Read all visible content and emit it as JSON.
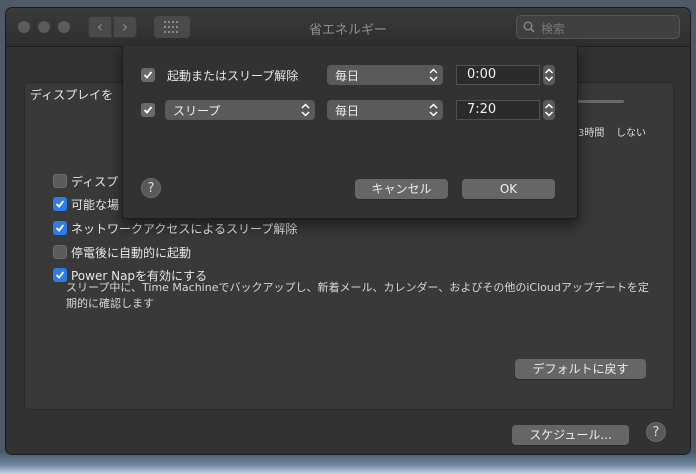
{
  "window": {
    "title": "省エネルギー"
  },
  "search": {
    "placeholder": "検索"
  },
  "panel": {
    "display_label": "ディスプレイを",
    "slider_ticks": [
      "3時間",
      "しない"
    ],
    "options": [
      {
        "label": "ディスプ",
        "checked": false
      },
      {
        "label": "可能な場",
        "checked": true
      },
      {
        "label": "ネットワークアクセスによるスリープ解除",
        "checked": true
      },
      {
        "label": "停電後に自動的に起動",
        "checked": false
      },
      {
        "label": "Power Napを有効にする",
        "checked": true
      }
    ],
    "power_nap_desc": "スリープ中に、Time Machineでバックアップし、新着メール、カレンダー、およびその他のiCloudアップデートを定期的に確認します",
    "default_button": "デフォルトに戻す",
    "schedule_button": "スケジュール...",
    "help": "?"
  },
  "sheet": {
    "row1": {
      "checked": true,
      "label": "起動またはスリープ解除",
      "day": "毎日",
      "time": "0:00"
    },
    "row2": {
      "checked": true,
      "action": "スリープ",
      "day": "毎日",
      "time": "7:20"
    },
    "help": "?",
    "cancel": "キャンセル",
    "ok": "OK"
  }
}
